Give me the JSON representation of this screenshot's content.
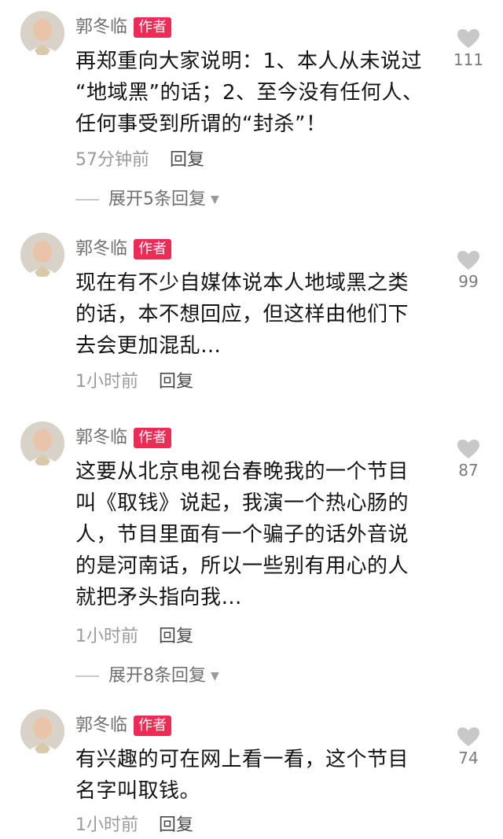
{
  "comments": [
    {
      "author": "郭冬临",
      "badge": "作者",
      "text": "再郑重向大家说明：1、本人从未说过\n“地域黑”的话；2、至今没有任何人、\n任何事受到所谓的“封杀”！",
      "time": "57分钟前",
      "reply": "回复",
      "likes": "111",
      "expand": "展开5条回复"
    },
    {
      "author": "郭冬临",
      "badge": "作者",
      "text": "现在有不少自媒体说本人地域黑之类\n的话，本不想回应，但这样由他们下\n去会更加混乱…",
      "time": "1小时前",
      "reply": "回复",
      "likes": "99"
    },
    {
      "author": "郭冬临",
      "badge": "作者",
      "text": "这要从北京电视台春晚我的一个节目\n叫《取钱》说起，我演一个热心肠的\n人，节目里面有一个骗子的话外音说\n的是河南话，所以一些别有用心的人\n就把矛头指向我…",
      "time": "1小时前",
      "reply": "回复",
      "likes": "87",
      "expand": "展开8条回复"
    },
    {
      "author": "郭冬临",
      "badge": "作者",
      "text": "有兴趣的可在网上看一看，这个节目\n名字叫取钱。",
      "time": "1小时前",
      "reply": "回复",
      "likes": "74"
    }
  ],
  "colors": {
    "badge": "#ee2a55",
    "like_icon": "#c8c8c8"
  },
  "icons": {
    "like": "heart-icon",
    "expand": "chevron-down-icon"
  }
}
